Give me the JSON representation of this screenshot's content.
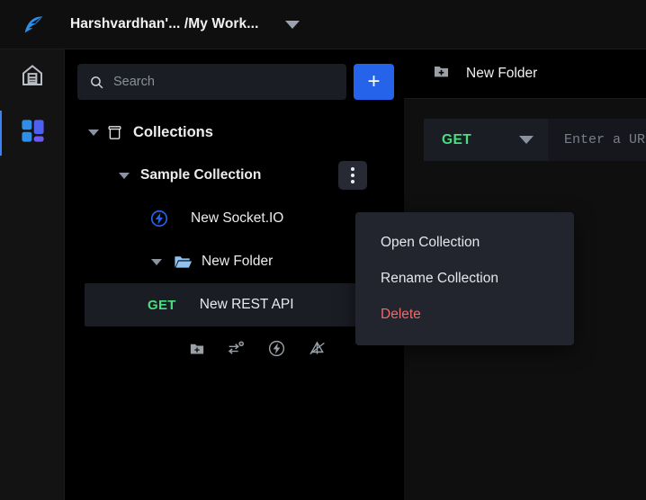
{
  "header": {
    "logo_icon": "hoppscotch-bird-logo",
    "workspace_title": "Harshvardhan'... /My Work...",
    "caret_icon": "chevron-down-icon"
  },
  "activity_bar": {
    "items": [
      {
        "name": "home",
        "icon": "home-icon",
        "active": false
      },
      {
        "name": "collections",
        "icon": "grid-apps-icon",
        "active": true
      }
    ]
  },
  "sidebar": {
    "search": {
      "placeholder": "Search",
      "value": "",
      "icon": "search-icon"
    },
    "add_button": {
      "label": "+",
      "icon": "plus-icon"
    },
    "tree": {
      "root": {
        "label": "Collections",
        "icon": "archive-box-icon",
        "expanded": true
      },
      "collection": {
        "label": "Sample Collection",
        "expanded": true,
        "menu_icon": "kebab-menu-icon"
      },
      "socketio": {
        "label": "New Socket.IO",
        "icon": "lightning-circle-icon"
      },
      "folder": {
        "label": "New Folder",
        "icon": "folder-open-icon",
        "expanded": true
      },
      "request": {
        "method": "GET",
        "label": "New REST API",
        "selected": true
      }
    },
    "toolbar": [
      {
        "name": "new-folder",
        "icon": "folder-plus-icon"
      },
      {
        "name": "new-request",
        "icon": "arrows-plus-icon"
      },
      {
        "name": "new-socketio",
        "icon": "lightning-circle-icon"
      },
      {
        "name": "new-graphql",
        "icon": "graphql-icon"
      }
    ]
  },
  "context_menu": {
    "items": [
      {
        "label": "Open Collection",
        "danger": false
      },
      {
        "label": "Rename Collection",
        "danger": false
      },
      {
        "label": "Delete",
        "danger": true
      }
    ]
  },
  "main": {
    "tab": {
      "label": "New Folder",
      "icon": "folder-plus-icon"
    },
    "request": {
      "method": "GET",
      "method_caret_icon": "chevron-down-icon",
      "url_placeholder": "Enter a URL",
      "url_value": ""
    }
  },
  "colors": {
    "accent_blue": "#2563eb",
    "method_green": "#4ade80",
    "danger_red": "#f06a6a",
    "panel_bg": "#000000",
    "surface": "#1b1d25",
    "menu_bg": "#22242e"
  }
}
